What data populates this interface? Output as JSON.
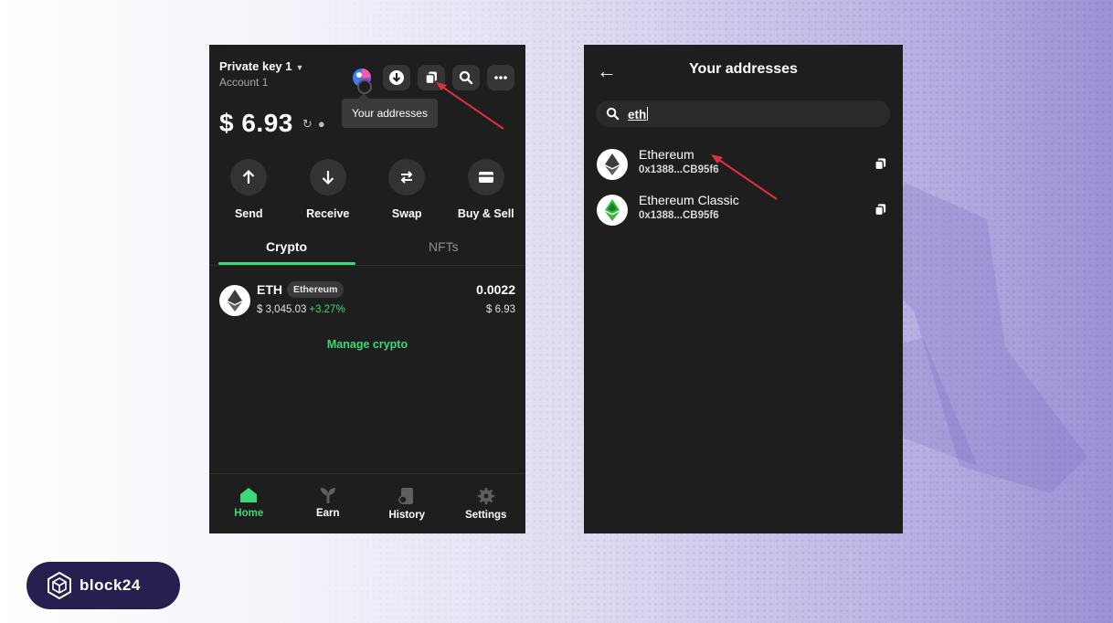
{
  "left_panel": {
    "account_title": "Private key 1",
    "account_subtitle": "Account 1",
    "tooltip": "Your addresses",
    "balance": "$ 6.93",
    "actions": [
      {
        "label": "Send",
        "icon": "arrow-up-icon"
      },
      {
        "label": "Receive",
        "icon": "arrow-down-icon"
      },
      {
        "label": "Swap",
        "icon": "swap-icon"
      },
      {
        "label": "Buy & Sell",
        "icon": "card-icon"
      }
    ],
    "tabs": [
      {
        "label": "Crypto",
        "active": true
      },
      {
        "label": "NFTs",
        "active": false
      }
    ],
    "assets": [
      {
        "symbol": "ETH",
        "network_badge": "Ethereum",
        "price": "$ 3,045.03",
        "change": "+3.27%",
        "amount": "0.0022",
        "fiat_value": "$ 6.93"
      }
    ],
    "manage_link": "Manage crypto",
    "bottom_nav": [
      {
        "label": "Home",
        "icon": "home-icon",
        "active": true
      },
      {
        "label": "Earn",
        "icon": "sprout-icon",
        "active": false
      },
      {
        "label": "History",
        "icon": "history-icon",
        "active": false
      },
      {
        "label": "Settings",
        "icon": "gear-icon",
        "active": false
      }
    ]
  },
  "right_panel": {
    "title": "Your addresses",
    "search_value": "eth",
    "addresses": [
      {
        "name": "Ethereum",
        "address": "0x1388...CB95f6"
      },
      {
        "name": "Ethereum Classic",
        "address": "0x1388...CB95f6"
      }
    ]
  },
  "brand": {
    "logo_text": "block24"
  },
  "colors": {
    "accent_green": "#3dd878",
    "panel_bg": "#1e1e1e",
    "annotation_red": "#e0303a",
    "brand_pill": "#261f4f"
  }
}
